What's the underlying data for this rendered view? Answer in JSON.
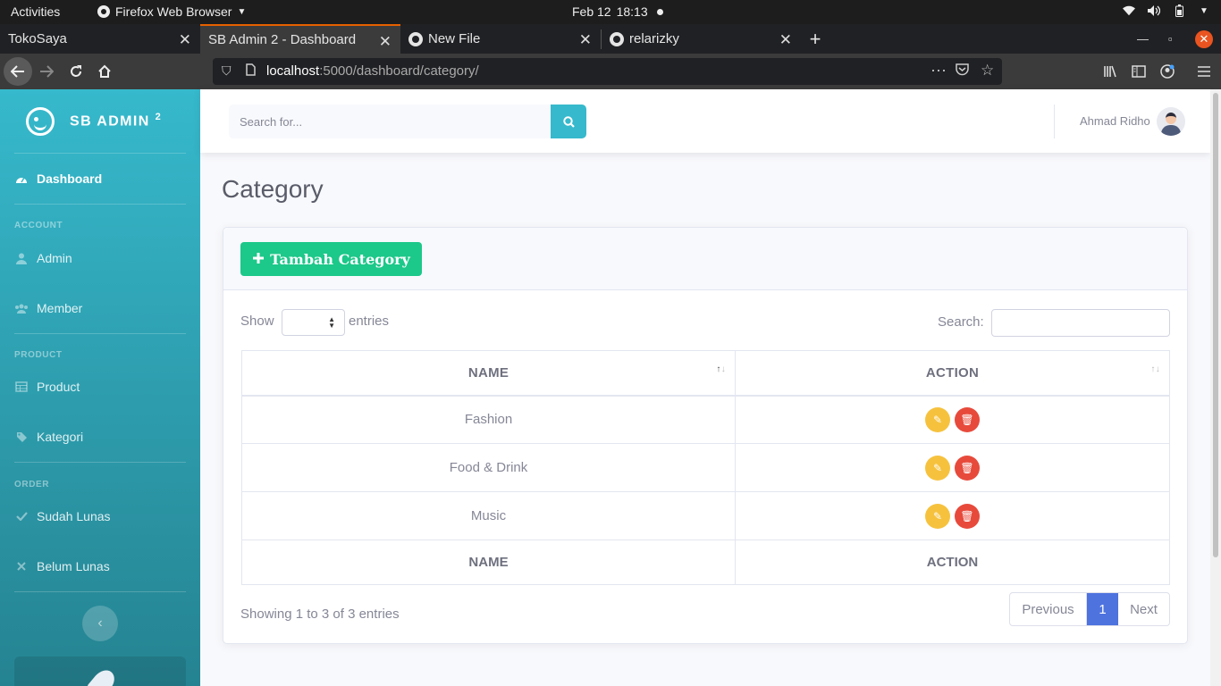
{
  "os": {
    "activities": "Activities",
    "app_name": "Firefox Web Browser",
    "date": "Feb 12",
    "time": "18:13"
  },
  "browser": {
    "tabs": [
      {
        "title": "TokoSaya",
        "active": false
      },
      {
        "title": "SB Admin 2 - Dashboard",
        "active": true
      },
      {
        "title": "New File",
        "active": false
      },
      {
        "title": "relarizky",
        "active": false
      }
    ],
    "url_host": "localhost",
    "url_rest": ":5000/dashboard/category/"
  },
  "sidebar": {
    "brand": "SB ADMIN",
    "brand_sup": "2",
    "dashboard": "Dashboard",
    "heading_account": "ACCOUNT",
    "admin": "Admin",
    "member": "Member",
    "heading_product": "PRODUCT",
    "product": "Product",
    "kategori": "Kategori",
    "heading_order": "ORDER",
    "sudah_lunas": "Sudah Lunas",
    "belum_lunas": "Belum Lunas"
  },
  "topnav": {
    "search_placeholder": "Search for...",
    "username": "Ahmad Ridho"
  },
  "main": {
    "page_title": "Category",
    "add_button": "Tambah Category",
    "show_label": "Show",
    "entries_label": "entries",
    "search_label": "Search:",
    "columns": [
      "NAME",
      "ACTION"
    ],
    "rows": [
      {
        "name": "Fashion"
      },
      {
        "name": "Food & Drink"
      },
      {
        "name": "Music"
      }
    ],
    "footer_columns": [
      "NAME",
      "ACTION"
    ],
    "info": "Showing 1 to 3 of 3 entries",
    "pagination": {
      "previous": "Previous",
      "current": "1",
      "next": "Next"
    }
  },
  "colors": {
    "sidebar": "#36b9cc",
    "add_button": "#1cc88a",
    "edit": "#f6c23e",
    "delete": "#e74a3b",
    "pagination_active": "#4e73df"
  }
}
